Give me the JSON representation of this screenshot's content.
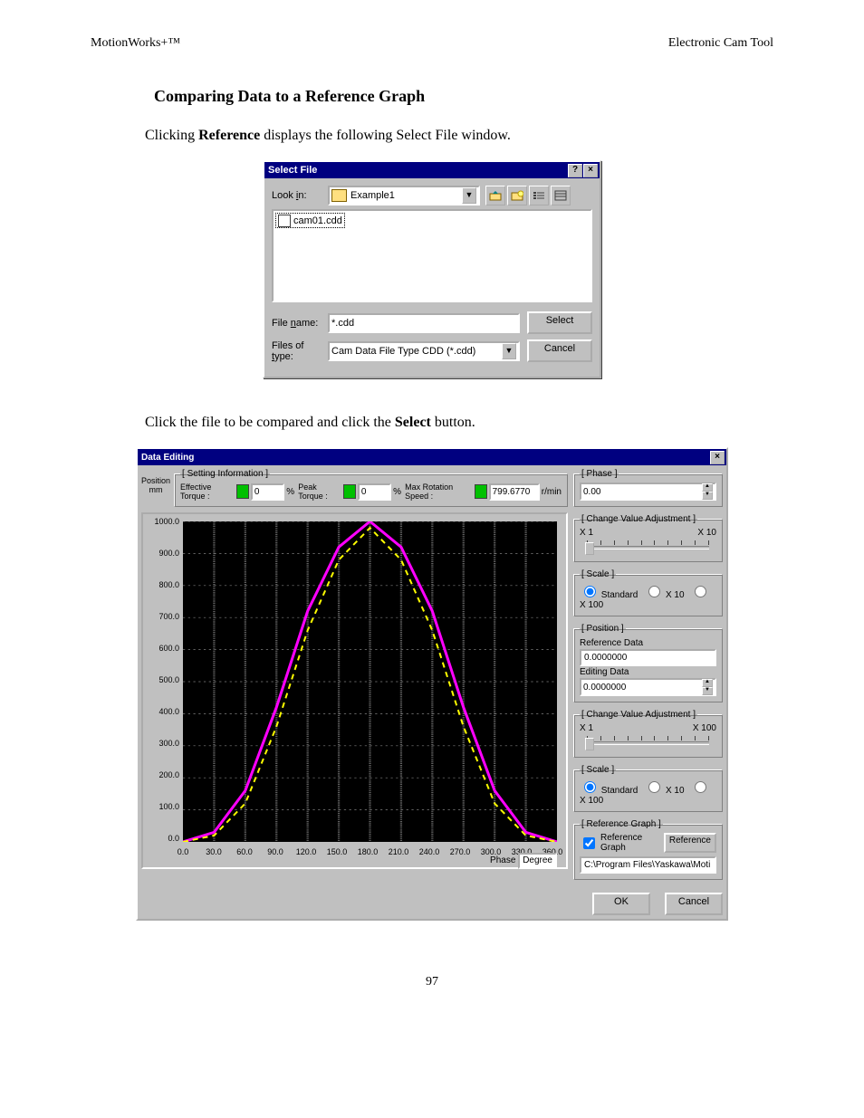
{
  "header_left": "MotionWorks+™",
  "header_right": "Electronic Cam Tool",
  "section_title": "Comparing Data to a Reference Graph",
  "intro_pre": "Clicking ",
  "intro_bold": "Reference",
  "intro_post": " displays the following Select File window.",
  "mid_pre": "Click the file to be compared and click the ",
  "mid_bold": "Select",
  "mid_post": " button.",
  "page_number": "97",
  "select_file": {
    "title": "Select File",
    "look_in_label": "Look in:",
    "look_in_value": "Example1",
    "file_item": "cam01.cdd",
    "file_name_label": "File name:",
    "file_name_value": "*.cdd",
    "file_type_label": "Files of type:",
    "file_type_value": "Cam Data File Type CDD (*.cdd)",
    "btn_select": "Select",
    "btn_cancel": "Cancel"
  },
  "data_editing": {
    "title": "Data Editing",
    "setting_info_legend": "[ Setting Information ]",
    "position_label": "Position",
    "position_unit": "mm",
    "eff_torque_label": "Effective Torque :",
    "eff_torque_value": "0",
    "eff_torque_unit": "%",
    "peak_torque_label": "Peak Torque :",
    "peak_torque_value": "0",
    "peak_torque_unit": "%",
    "max_rot_label": "Max Rotation Speed :",
    "max_rot_value": "799.6770",
    "max_rot_unit": "r/min",
    "phase_legend": "[ Phase ]",
    "phase_value": "0.00",
    "cva_legend": "[ Change Value Adjustment ]",
    "cva_left": "X 1",
    "cva_right_phase": "X 10",
    "scale_legend": "[ Scale ]",
    "scale_std": "Standard",
    "scale_x10": "X 10",
    "scale_x100": "X 100",
    "position_legend": "[ Position ]",
    "ref_data_label": "Reference Data",
    "ref_data_value": "0.0000000",
    "edit_data_label": "Editing Data",
    "edit_data_value": "0.0000000",
    "cva_right_pos": "X 100",
    "ref_graph_legend": "[ Reference Graph ]",
    "ref_graph_check": "Reference Graph",
    "ref_btn": "Reference",
    "ref_path": "C:\\Program Files\\Yaskawa\\Moti",
    "x_axis_label": "Phase",
    "x_axis_unit": "Degree",
    "btn_ok": "OK",
    "btn_cancel": "Cancel"
  },
  "chart_data": {
    "type": "line",
    "xlabel": "Phase",
    "x_unit": "Degree",
    "ylabel": "Position",
    "y_unit": "mm",
    "xlim": [
      0,
      360
    ],
    "ylim": [
      0,
      1000
    ],
    "x_ticks": [
      0,
      30,
      60,
      90,
      120,
      150,
      180,
      210,
      240,
      270,
      300,
      330,
      360
    ],
    "y_ticks": [
      0,
      100,
      200,
      300,
      400,
      500,
      600,
      700,
      800,
      900,
      1000
    ],
    "series": [
      {
        "name": "Editing Data",
        "color": "#ff00ff",
        "style": "solid",
        "x": [
          0,
          30,
          60,
          90,
          120,
          150,
          180,
          210,
          240,
          270,
          300,
          330,
          360
        ],
        "values": [
          0,
          30,
          160,
          420,
          720,
          920,
          1000,
          920,
          720,
          420,
          160,
          30,
          0
        ]
      },
      {
        "name": "Reference Data",
        "color": "#ffff00",
        "style": "dashed",
        "x": [
          0,
          30,
          60,
          90,
          120,
          150,
          180,
          210,
          240,
          270,
          300,
          330,
          360
        ],
        "values": [
          0,
          20,
          120,
          360,
          660,
          880,
          980,
          880,
          660,
          360,
          120,
          20,
          0
        ]
      }
    ]
  }
}
